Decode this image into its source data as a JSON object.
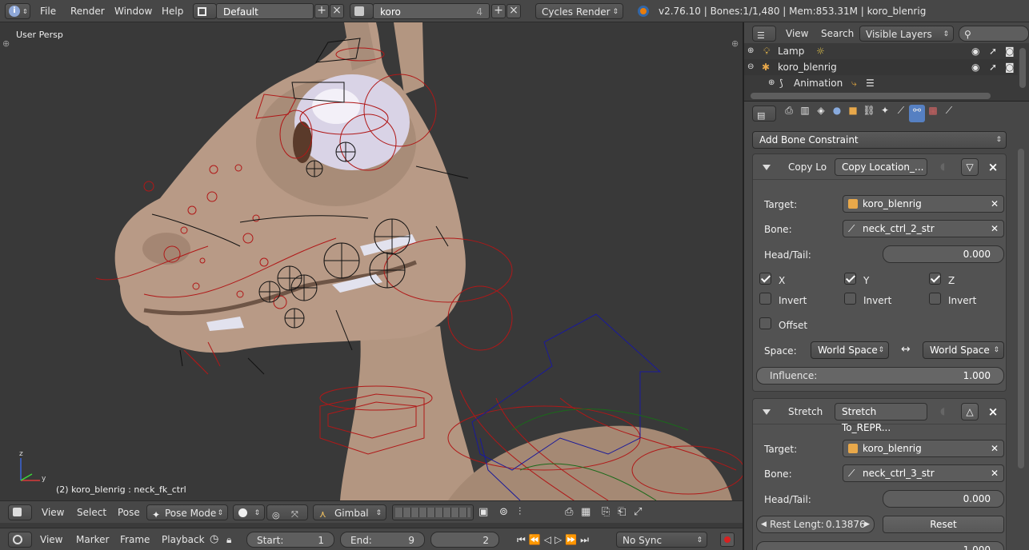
{
  "topbar": {
    "menus": [
      "File",
      "Render",
      "Window",
      "Help"
    ],
    "layout_name": "Default",
    "scene_name": "koro",
    "scene_users": "4",
    "render_engine": "Cycles Render",
    "stats": "v2.76.10 | Bones:1/1,480  | Mem:853.31M | koro_blenrig"
  },
  "viewport": {
    "label": "User Persp",
    "status": "(2) koro_blenrig : neck_fk_ctrl",
    "axis_x": "y",
    "axis_z": "z"
  },
  "viewport_header": {
    "menus": [
      "View",
      "Select",
      "Pose"
    ],
    "mode": "Pose Mode",
    "orientation": "Gimbal"
  },
  "timeline": {
    "menus": [
      "View",
      "Marker",
      "Frame",
      "Playback"
    ],
    "start_label": "Start:",
    "start_value": "1",
    "end_label": "End:",
    "end_value": "9",
    "current_frame": "2",
    "sync": "No Sync"
  },
  "outliner": {
    "menus": [
      "View",
      "Search"
    ],
    "filter": "Visible Layers",
    "rows": [
      {
        "label": "Lamp"
      },
      {
        "label": "koro_blenrig"
      },
      {
        "label": "Animation"
      }
    ]
  },
  "properties": {
    "add_constraint": "Add Bone Constraint",
    "constraints": [
      {
        "short_name": "Copy Lo",
        "name_field": "Copy Location_...",
        "target_label": "Target:",
        "target": "koro_blenrig",
        "bone_label": "Bone:",
        "bone": "neck_ctrl_2_str",
        "headtail_label": "Head/Tail:",
        "headtail": "0.000",
        "axes": [
          "X",
          "Y",
          "Z"
        ],
        "invert_label": "Invert",
        "offset_label": "Offset",
        "space_label": "Space:",
        "owner_space": "World Space",
        "target_space": "World Space",
        "influence_label": "Influence:",
        "influence": "1.000"
      },
      {
        "short_name": "Stretch",
        "name_field": "Stretch To_REPR...",
        "target_label": "Target:",
        "target": "koro_blenrig",
        "bone_label": "Bone:",
        "bone": "neck_ctrl_3_str",
        "headtail_label": "Head/Tail:",
        "headtail": "0.000",
        "rest_length_label": "Rest Lengt:",
        "rest_length": "0.13876",
        "reset_label": "Reset",
        "partial_value": "1.000"
      }
    ]
  },
  "colors": {
    "bg": "#393939",
    "header": "#474747",
    "panel": "#525252",
    "bone_red": "#b01818",
    "bone_black": "#111111",
    "bone_blue": "#1a1a9a",
    "skin": "#b39681"
  }
}
